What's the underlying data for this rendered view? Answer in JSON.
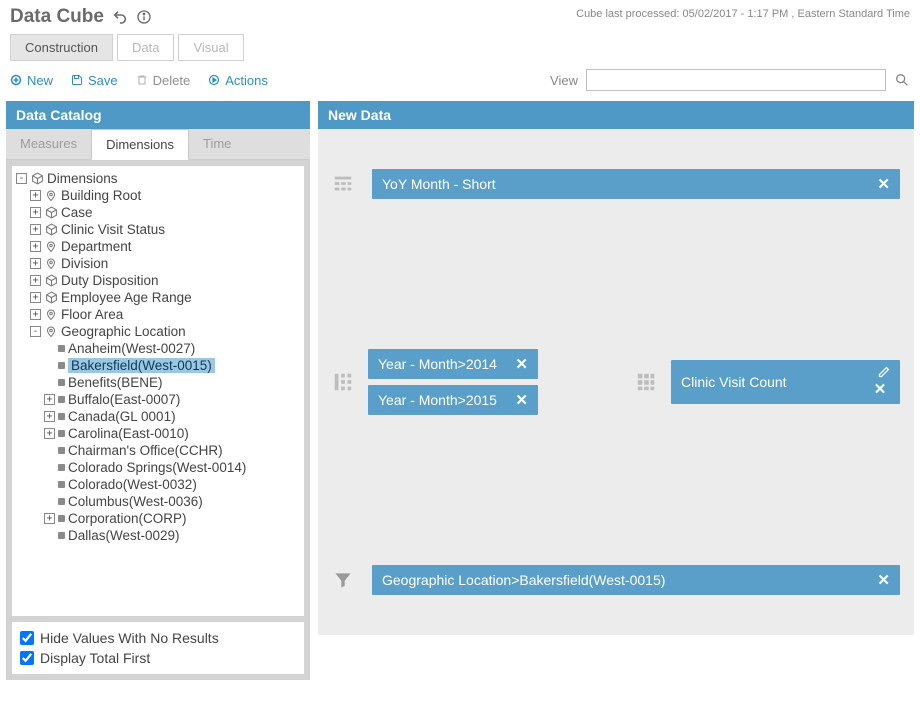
{
  "header": {
    "title": "Data Cube",
    "processed_label": "Cube last processed:",
    "processed_value": "05/02/2017 - 1:17 PM , Eastern Standard Time"
  },
  "modes": {
    "construction": "Construction",
    "data": "Data",
    "visual": "Visual"
  },
  "toolbar": {
    "new": "New",
    "save": "Save",
    "delete": "Delete",
    "actions": "Actions",
    "view_label": "View"
  },
  "catalog": {
    "header": "Data Catalog",
    "tabs": {
      "measures": "Measures",
      "dimensions": "Dimensions",
      "time": "Time"
    },
    "root": "Dimensions",
    "items": [
      {
        "label": "Building Root",
        "icon": "pin"
      },
      {
        "label": "Case",
        "icon": "cube"
      },
      {
        "label": "Clinic Visit Status",
        "icon": "cube"
      },
      {
        "label": "Department",
        "icon": "pin"
      },
      {
        "label": "Division",
        "icon": "pin"
      },
      {
        "label": "Duty Disposition",
        "icon": "cube"
      },
      {
        "label": "Employee Age Range",
        "icon": "cube"
      },
      {
        "label": "Floor Area",
        "icon": "pin"
      }
    ],
    "geo": {
      "label": "Geographic Location",
      "children": [
        {
          "label": "Anaheim(West-0027)",
          "exp": "none"
        },
        {
          "label": "Bakersfield(West-0015)",
          "exp": "none",
          "selected": true
        },
        {
          "label": "Benefits(BENE)",
          "exp": "none"
        },
        {
          "label": "Buffalo(East-0007)",
          "exp": "plus"
        },
        {
          "label": "Canada(GL 0001)",
          "exp": "plus"
        },
        {
          "label": "Carolina(East-0010)",
          "exp": "plus"
        },
        {
          "label": "Chairman's Office(CCHR)",
          "exp": "none"
        },
        {
          "label": "Colorado Springs(West-0014)",
          "exp": "none"
        },
        {
          "label": "Colorado(West-0032)",
          "exp": "none"
        },
        {
          "label": "Columbus(West-0036)",
          "exp": "none"
        },
        {
          "label": "Corporation(CORP)",
          "exp": "plus"
        },
        {
          "label": "Dallas(West-0029)",
          "exp": "none"
        }
      ]
    },
    "options": {
      "hide": "Hide Values With No Results",
      "total": "Display Total First"
    }
  },
  "design": {
    "header": "New Data",
    "top_chip": "YoY Month - Short",
    "left_chips": [
      "Year - Month>2014",
      "Year - Month>2015"
    ],
    "right_chip": "Clinic Visit Count",
    "filter_chip": "Geographic Location>Bakersfield(West-0015)"
  }
}
